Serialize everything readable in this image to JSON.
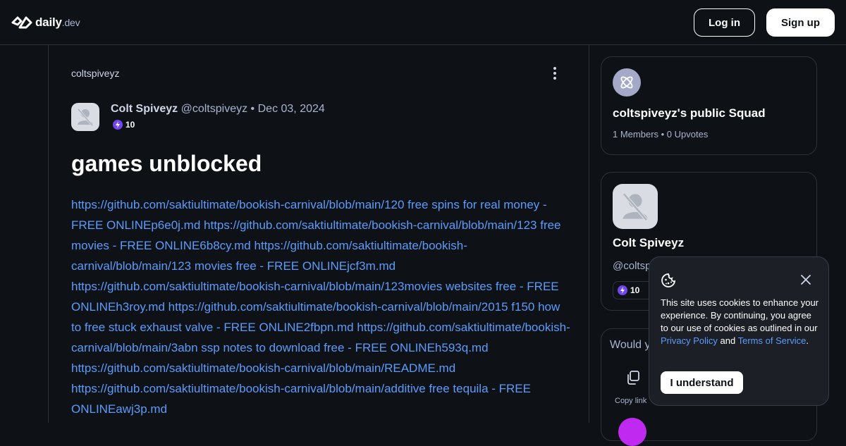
{
  "header": {
    "logo_main": "daily",
    "logo_suffix": ".dev",
    "login_label": "Log in",
    "signup_label": "Sign up"
  },
  "post": {
    "squad_handle": "coltspiveyz",
    "author_name": "Colt Spiveyz",
    "author_handle": "@coltspiveyz",
    "separator": "•",
    "date": "Dec 03, 2024",
    "reputation": "10",
    "title": "games unblocked",
    "links": [
      "https://github.com/saktiultimate/bookish-carnival/blob/main/120 free spins for real money - FREE ONLINEp6e0j.md",
      "https://github.com/saktiultimate/bookish-carnival/blob/main/123 free movies - FREE ONLINE6b8cy.md",
      "https://github.com/saktiultimate/bookish-carnival/blob/main/123 movies free - FREE ONLINEjcf3m.md",
      "https://github.com/saktiultimate/bookish-carnival/blob/main/123movies websites free - FREE ONLINEh3roy.md",
      "https://github.com/saktiultimate/bookish-carnival/blob/main/2015 f150 how to free stuck exhaust valve - FREE ONLINE2fbpn.md",
      "https://github.com/saktiultimate/bookish-carnival/blob/main/3abn ssp notes to download free - FREE ONLINEh593q.md",
      "https://github.com/saktiultimate/bookish-carnival/blob/main/README.md",
      "https://github.com/saktiultimate/bookish-carnival/blob/main/additive free tequila - FREE ONLINEawj3p.md"
    ]
  },
  "sidebar": {
    "squad": {
      "name": "coltspiveyz's public Squad",
      "stats": "1 Members • 0 Upvotes"
    },
    "user": {
      "name": "Colt Spiveyz",
      "handle": "@coltspiveyz",
      "reputation": "10"
    },
    "share": {
      "title": "Would you recommend this post?",
      "copy_label": "Copy link"
    }
  },
  "cookie": {
    "text_before": "This site uses cookies to enhance your experience. By continuing, you agree to our use of cookies as outlined in our ",
    "privacy_label": "Privacy Policy",
    "and": " and ",
    "terms_label": "Terms of Service",
    "period": ".",
    "button_label": "I understand"
  },
  "colors": {
    "background": "#0e1217",
    "link": "#5c9bfa",
    "reputation": "#7147ed",
    "border": "#2d323b"
  }
}
